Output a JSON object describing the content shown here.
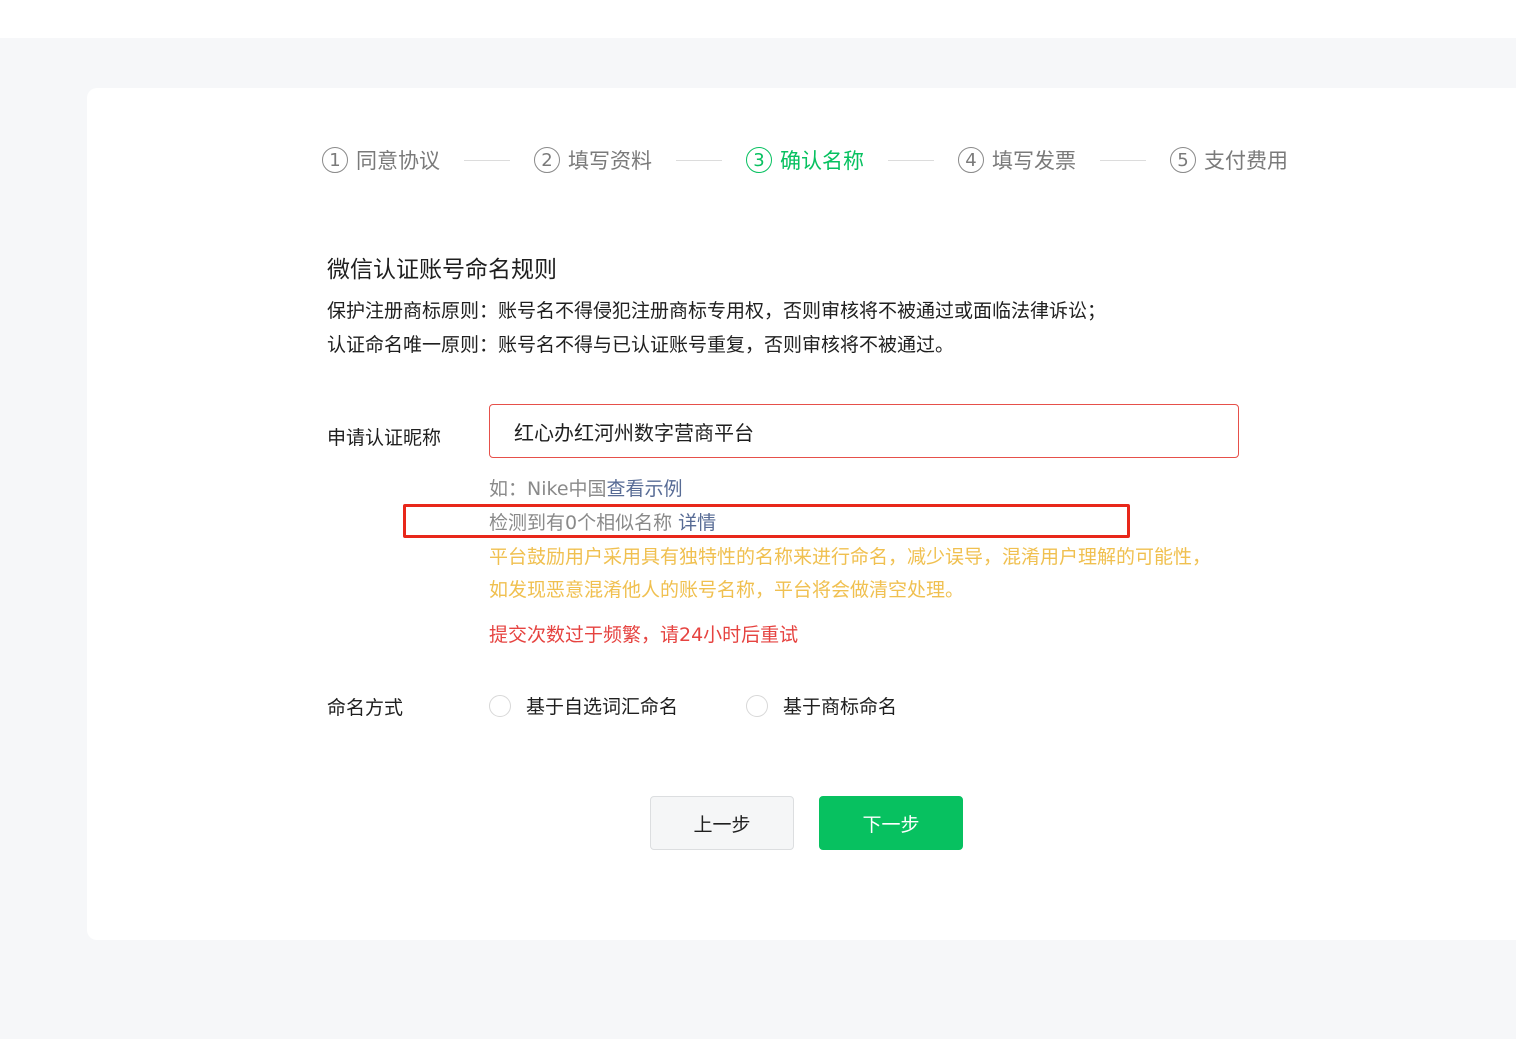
{
  "steps": [
    {
      "num": "1",
      "label": "同意协议",
      "state": "done"
    },
    {
      "num": "2",
      "label": "填写资料",
      "state": "done"
    },
    {
      "num": "3",
      "label": "确认名称",
      "state": "active"
    },
    {
      "num": "4",
      "label": "填写发票",
      "state": "todo"
    },
    {
      "num": "5",
      "label": "支付费用",
      "state": "todo"
    }
  ],
  "rules": {
    "title": "微信认证账号命名规则",
    "line1": "保护注册商标原则：账号名不得侵犯注册商标专用权，否则审核将不被通过或面临法律诉讼；",
    "line2": "认证命名唯一原则：账号名不得与已认证账号重复，否则审核将不被通过。"
  },
  "form": {
    "nickname_label": "申请认证昵称",
    "nickname_value": "红心办红河州数字营商平台",
    "example_prefix": "如：Nike中国",
    "example_link": "查看示例",
    "similar_text": "检测到有0个相似名称",
    "similar_link": "详情",
    "encourage_line1": "平台鼓励用户采用具有独特性的名称来进行命名，减少误导，混淆用户理解的可能性，",
    "encourage_line2": "如发现恶意混淆他人的账号名称，平台将会做清空处理。",
    "error_text": "提交次数过于频繁，请24小时后重试",
    "naming_label": "命名方式",
    "naming_options": [
      "基于自选词汇命名",
      "基于商标命名"
    ]
  },
  "buttons": {
    "prev": "上一步",
    "next": "下一步"
  },
  "colors": {
    "primary": "#07c160",
    "error": "#e64340",
    "warning": "#f0c050",
    "link": "#576b95",
    "annotation": "#e8271a"
  }
}
